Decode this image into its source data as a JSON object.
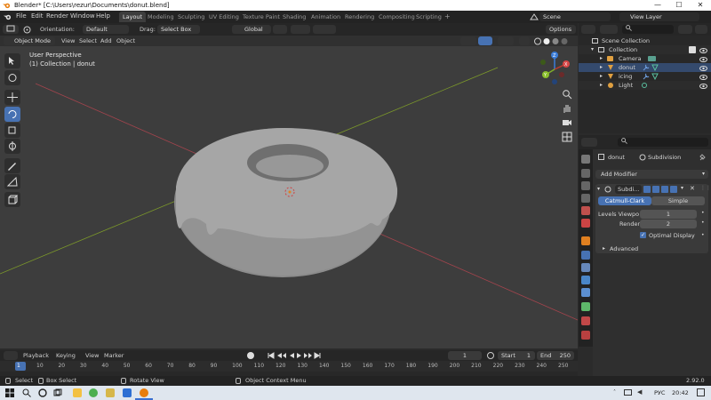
{
  "window": {
    "title": "Blender* [C:\\Users\\rezur\\Documents\\donut.blend]",
    "minimize": "—",
    "maximize": "☐",
    "close": "✕"
  },
  "menubar": {
    "items": [
      "File",
      "Edit",
      "Render",
      "Window",
      "Help"
    ],
    "workspaces": [
      "Layout",
      "Modeling",
      "Sculpting",
      "UV Editing",
      "Texture Paint",
      "Shading",
      "Animation",
      "Rendering",
      "Compositing",
      "Scripting"
    ],
    "active_workspace": "Layout",
    "add_tab": "+",
    "scene_label": "Scene",
    "view_layer_label": "View Layer"
  },
  "viewport_header": {
    "orientation_label": "Orientation:",
    "orientation_value": "Default",
    "drag_label": "Drag:",
    "drag_value": "Select Box",
    "transform_value": "Global",
    "mode_value": "Object Mode",
    "menus": [
      "View",
      "Select",
      "Add",
      "Object"
    ],
    "options_label": "Options"
  },
  "viewport": {
    "view_name": "User Perspective",
    "context": "(1) Collection | donut",
    "axis_labels": [
      "Z",
      "Y",
      "X"
    ]
  },
  "outliner": {
    "search_placeholder": "",
    "rows": [
      {
        "label": "Scene Collection"
      },
      {
        "label": "Collection"
      },
      {
        "label": "Camera"
      },
      {
        "label": "donut"
      },
      {
        "label": "icing"
      },
      {
        "label": "Light"
      }
    ]
  },
  "properties": {
    "object_name": "donut",
    "modifier_context": "Subdivision",
    "add_modifier": "Add Modifier",
    "modifier_short_name": "Subdi...",
    "algorithm_options": [
      "Catmull-Clark",
      "Simple"
    ],
    "active_algorithm": "Catmull-Clark",
    "levels_viewport_label": "Levels Viewpo",
    "levels_viewport_value": "1",
    "render_label": "Render",
    "render_value": "2",
    "optimal_display_label": "Optimal Display",
    "optimal_display_checked": true,
    "advanced_label": "Advanced"
  },
  "timeline": {
    "menus": [
      "Playback",
      "Keying",
      "View",
      "Marker"
    ],
    "current_frame": "1",
    "start_label": "Start",
    "start_value": "1",
    "end_label": "End",
    "end_value": "250",
    "ruler": [
      "1",
      "10",
      "20",
      "30",
      "40",
      "50",
      "60",
      "70",
      "80",
      "90",
      "100",
      "110",
      "120",
      "130",
      "140",
      "150",
      "160",
      "170",
      "180",
      "190",
      "200",
      "210",
      "220",
      "230",
      "240",
      "250"
    ]
  },
  "statusbar": {
    "select": "Select",
    "box_select": "Box Select",
    "rotate_view": "Rotate View",
    "context_menu": "Object Context Menu",
    "version": "2.92.0"
  },
  "taskbar": {
    "language": "РУС",
    "time": "20:42"
  },
  "colors": {
    "accent": "#4772b3",
    "viewport_bg": "#3d3d3d",
    "x_axis": "#b7444d",
    "y_axis": "#7f9e2a",
    "donut": "#8f8f8f",
    "icing": "#a9a9a9"
  }
}
